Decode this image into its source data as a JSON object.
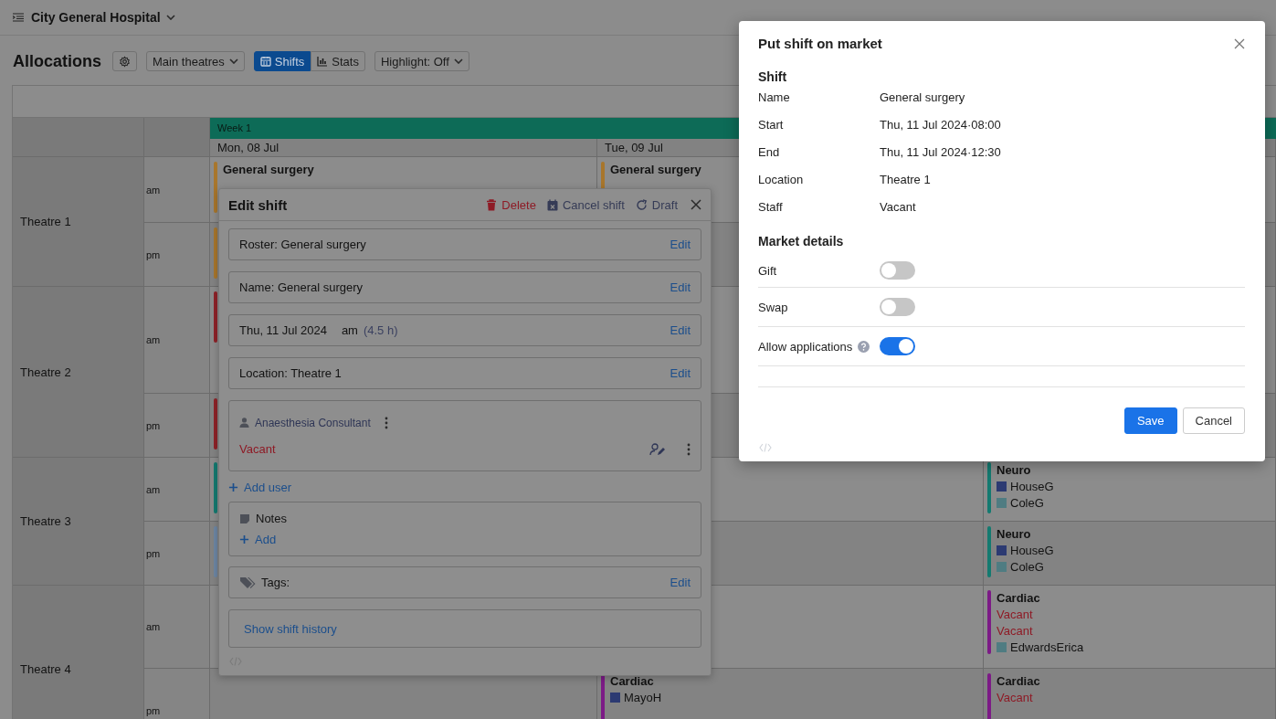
{
  "app": {
    "hospital": "City General Hospital"
  },
  "toolbar": {
    "title": "Allocations",
    "view_select": "Main theatres",
    "tabs": [
      {
        "kind": "calendar",
        "label": "Shifts",
        "selected": true
      },
      {
        "kind": "chart",
        "label": "Stats",
        "selected": false
      }
    ],
    "highlight": "Highlight: Off"
  },
  "grid": {
    "week": "Week 1",
    "days": [
      "Mon, 08 Jul",
      "Tue, 09 Jul"
    ],
    "theatres": [
      {
        "name": "Theatre 1",
        "sessions": [
          {
            "label": "am",
            "cells": [
              {
                "kind": "shift",
                "color": "#a8762c",
                "title": "General surgery"
              },
              {
                "kind": "shift",
                "color": "#a8762c",
                "title": "General surgery"
              },
              {
                "kind": "empty"
              }
            ]
          },
          {
            "label": "pm",
            "cells": [
              {
                "kind": "shift",
                "color": "#a8762c"
              },
              {
                "kind": "empty"
              },
              {
                "kind": "empty"
              }
            ]
          }
        ]
      },
      {
        "name": "Theatre 2",
        "sessions": [
          {
            "label": "am",
            "cells": [
              {
                "kind": "shift",
                "color": "#8e2228"
              },
              {
                "kind": "empty"
              },
              {
                "kind": "empty"
              }
            ]
          },
          {
            "label": "pm",
            "cells": [
              {
                "kind": "shift",
                "color": "#8e2228"
              },
              {
                "kind": "empty"
              },
              {
                "kind": "empty"
              }
            ]
          }
        ]
      },
      {
        "name": "Theatre 3",
        "sessions": [
          {
            "label": "am",
            "cells": [
              {
                "kind": "shift",
                "color": "#137a70"
              },
              {
                "kind": "empty"
              },
              {
                "kind": "shift",
                "color": "#137a70",
                "title": "Neuro",
                "staff": [
                  {
                    "kind": "user",
                    "name": "HouseG",
                    "color": "#2c3a72"
                  },
                  {
                    "kind": "user",
                    "name": "ColeG",
                    "color": "#4f7c82"
                  }
                ]
              }
            ]
          },
          {
            "label": "pm",
            "cells": [
              {
                "kind": "shift",
                "color": "#6d86a4"
              },
              {
                "kind": "empty"
              },
              {
                "kind": "shift",
                "color": "#137a70",
                "title": "Neuro",
                "staff": [
                  {
                    "kind": "user",
                    "name": "HouseG",
                    "color": "#2c3a72"
                  },
                  {
                    "kind": "user",
                    "name": "ColeG",
                    "color": "#4f7c82"
                  }
                ]
              }
            ]
          }
        ]
      },
      {
        "name": "Theatre 4",
        "sessions": [
          {
            "label": "am",
            "cells": [
              {
                "kind": "empty"
              },
              {
                "kind": "empty"
              },
              {
                "kind": "shift",
                "color": "#7c1a86",
                "title": "Cardiac",
                "staff": [
                  {
                    "kind": "vacant",
                    "name": "Vacant"
                  },
                  {
                    "kind": "vacant",
                    "name": "Vacant"
                  },
                  {
                    "kind": "user",
                    "name": "EdwardsErica",
                    "color": "#4f7c82"
                  }
                ]
              }
            ]
          },
          {
            "label": "pm",
            "cells": [
              {
                "kind": "empty"
              },
              {
                "kind": "shift",
                "color": "#7c1a86",
                "title": "Cardiac",
                "staff": [
                  {
                    "kind": "user",
                    "name": "MayoH",
                    "color": "#2c3a72"
                  }
                ]
              },
              {
                "kind": "shift",
                "color": "#7c1a86",
                "title": "Cardiac",
                "staff": [
                  {
                    "kind": "vacant",
                    "name": "Vacant"
                  }
                ]
              }
            ]
          }
        ]
      }
    ]
  },
  "edit_shift": {
    "title": "Edit shift",
    "actions": [
      {
        "kind": "delete",
        "label": "Delete"
      },
      {
        "kind": "cancel",
        "label": "Cancel shift"
      },
      {
        "kind": "draft",
        "label": "Draft"
      }
    ],
    "fields": [
      {
        "kind": "text",
        "text": "Roster: General surgery",
        "action": "Edit"
      },
      {
        "kind": "text",
        "text": "Name: General surgery",
        "action": "Edit"
      },
      {
        "kind": "date",
        "date": "Thu, 11 Jul 2024",
        "session": "am",
        "duration": "(4.5 h)",
        "action": "Edit"
      },
      {
        "kind": "text",
        "text": "Location: Theatre 1",
        "action": "Edit"
      }
    ],
    "role": {
      "name": "Anaesthesia Consultant",
      "staff": "Vacant"
    },
    "add_user": "Add user",
    "notes": {
      "title": "Notes",
      "add": "Add"
    },
    "tags": {
      "label": "Tags:",
      "action": "Edit"
    },
    "history": "Show shift history"
  },
  "market": {
    "title": "Put shift on market",
    "shift_heading": "Shift",
    "details": [
      {
        "label": "Name",
        "value": "General surgery"
      },
      {
        "label": "Start",
        "value": "Thu, 11 Jul 2024·08:00"
      },
      {
        "label": "End",
        "value": "Thu, 11 Jul 2024·12:30"
      },
      {
        "label": "Location",
        "value": "Theatre 1"
      },
      {
        "label": "Staff",
        "value": "Vacant"
      }
    ],
    "market_heading": "Market details",
    "options": [
      {
        "label": "Gift",
        "on": false
      },
      {
        "label": "Swap",
        "on": false
      },
      {
        "label": "Allow applications",
        "on": true,
        "help": true
      }
    ],
    "buttons": [
      {
        "kind": "primary",
        "label": "Save"
      },
      {
        "kind": "secondary",
        "label": "Cancel"
      }
    ]
  }
}
